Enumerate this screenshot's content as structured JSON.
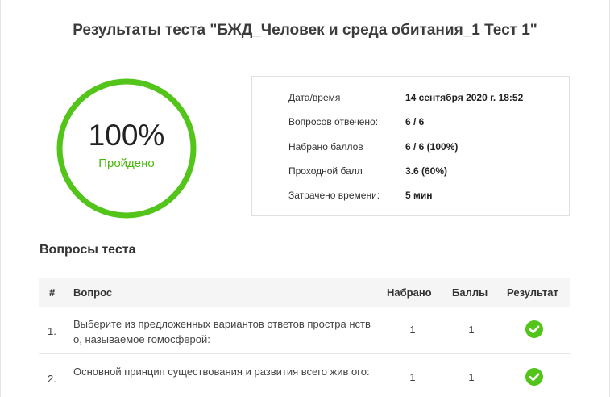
{
  "title": "Результаты теста \"БЖД_Человек и среда обитания_1 Тест 1\"",
  "score": {
    "percent_text": "100%",
    "percent_value": 100,
    "status": "Пройдено",
    "ring_color": "#52c41a"
  },
  "info": [
    {
      "label": "Дата/время",
      "value": "14 сентября 2020 г. 18:52"
    },
    {
      "label": "Вопросов отвечено:",
      "value": "6 / 6"
    },
    {
      "label": "Набрано баллов",
      "value": "6 / 6 (100%)"
    },
    {
      "label": "Проходной балл",
      "value": "3.6 (60%)"
    },
    {
      "label": "Затрачено времени:",
      "value": "5 мин"
    }
  ],
  "questions_section": {
    "title": "Вопросы теста",
    "headers": {
      "num": "#",
      "question": "Вопрос",
      "scored": "Набрано",
      "points": "Баллы",
      "result": "Результат"
    },
    "rows": [
      {
        "num": "1.",
        "question": "Выберите из предложенных вариантов ответов простра нство, называемое гомосферой:",
        "scored": "1",
        "points": "1",
        "result_icon": "check-circle-icon"
      },
      {
        "num": "2.",
        "question": "Основной принцип существования и развития всего жив ого:",
        "scored": "1",
        "points": "1",
        "result_icon": "check-circle-icon"
      }
    ]
  },
  "colors": {
    "success": "#52c41a",
    "status_text": "#4cb80f"
  }
}
